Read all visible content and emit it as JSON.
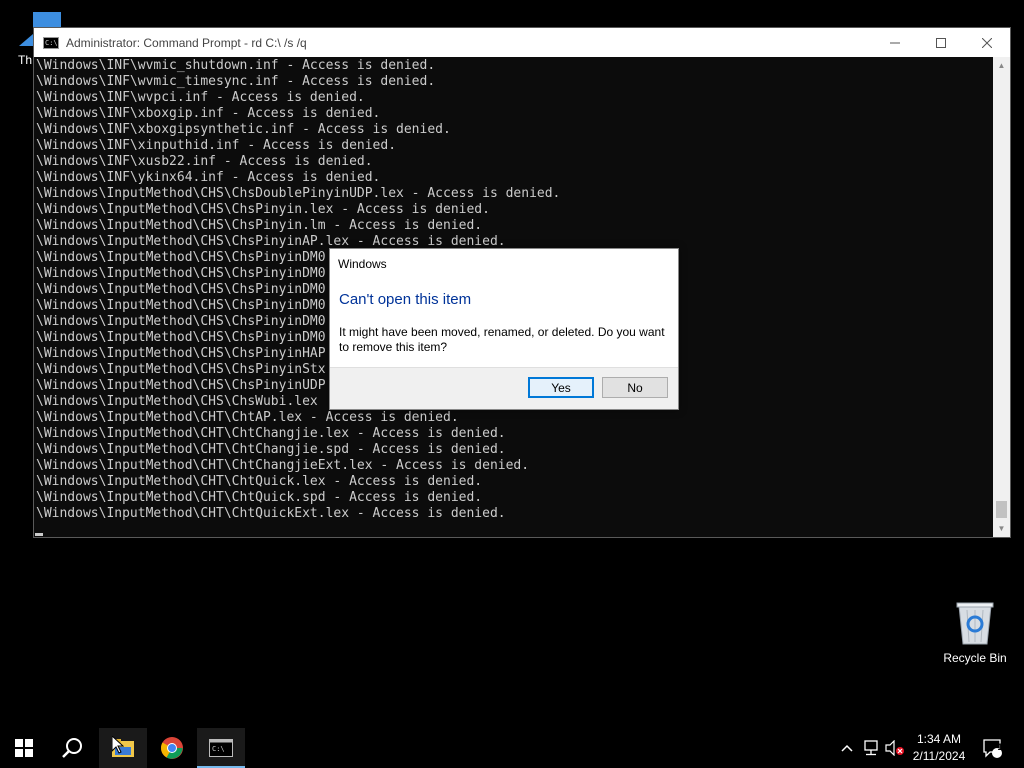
{
  "desktop": {
    "partial_icon_label": "Th",
    "recycle_bin_label": "Recycle Bin"
  },
  "cmd_window": {
    "title": "Administrator: Command Prompt - rd  C:\\ /s /q",
    "app_icon_text": "C:\\",
    "lines": [
      "\\Windows\\INF\\wvmic_shutdown.inf - Access is denied.",
      "\\Windows\\INF\\wvmic_timesync.inf - Access is denied.",
      "\\Windows\\INF\\wvpci.inf - Access is denied.",
      "\\Windows\\INF\\xboxgip.inf - Access is denied.",
      "\\Windows\\INF\\xboxgipsynthetic.inf - Access is denied.",
      "\\Windows\\INF\\xinputhid.inf - Access is denied.",
      "\\Windows\\INF\\xusb22.inf - Access is denied.",
      "\\Windows\\INF\\ykinx64.inf - Access is denied.",
      "\\Windows\\InputMethod\\CHS\\ChsDoublePinyinUDP.lex - Access is denied.",
      "\\Windows\\InputMethod\\CHS\\ChsPinyin.lex - Access is denied.",
      "\\Windows\\InputMethod\\CHS\\ChsPinyin.lm - Access is denied.",
      "\\Windows\\InputMethod\\CHS\\ChsPinyinAP.lex - Access is denied.",
      "\\Windows\\InputMethod\\CHS\\ChsPinyinDM0",
      "\\Windows\\InputMethod\\CHS\\ChsPinyinDM0",
      "\\Windows\\InputMethod\\CHS\\ChsPinyinDM0",
      "\\Windows\\InputMethod\\CHS\\ChsPinyinDM0",
      "\\Windows\\InputMethod\\CHS\\ChsPinyinDM0",
      "\\Windows\\InputMethod\\CHS\\ChsPinyinDM0",
      "\\Windows\\InputMethod\\CHS\\ChsPinyinHAP",
      "\\Windows\\InputMethod\\CHS\\ChsPinyinStx",
      "\\Windows\\InputMethod\\CHS\\ChsPinyinUDP",
      "\\Windows\\InputMethod\\CHS\\ChsWubi.lex",
      "\\Windows\\InputMethod\\CHT\\ChtAP.lex - Access is denied.",
      "\\Windows\\InputMethod\\CHT\\ChtChangjie.lex - Access is denied.",
      "\\Windows\\InputMethod\\CHT\\ChtChangjie.spd - Access is denied.",
      "\\Windows\\InputMethod\\CHT\\ChtChangjieExt.lex - Access is denied.",
      "\\Windows\\InputMethod\\CHT\\ChtQuick.lex - Access is denied.",
      "\\Windows\\InputMethod\\CHT\\ChtQuick.spd - Access is denied.",
      "\\Windows\\InputMethod\\CHT\\ChtQuickExt.lex - Access is denied."
    ]
  },
  "dialog": {
    "title": "Windows",
    "heading": "Can't open this item",
    "message": "It might have been moved, renamed, or deleted. Do you want to remove this item?",
    "yes_label": "Yes",
    "no_label": "No"
  },
  "taskbar": {
    "time": "1:34 AM",
    "date": "2/11/2024",
    "notification_count": "1"
  },
  "colors": {
    "console_bg": "#0c0c0c",
    "console_text": "#cccccc",
    "dialog_heading": "#003399",
    "accent": "#0078d7"
  }
}
